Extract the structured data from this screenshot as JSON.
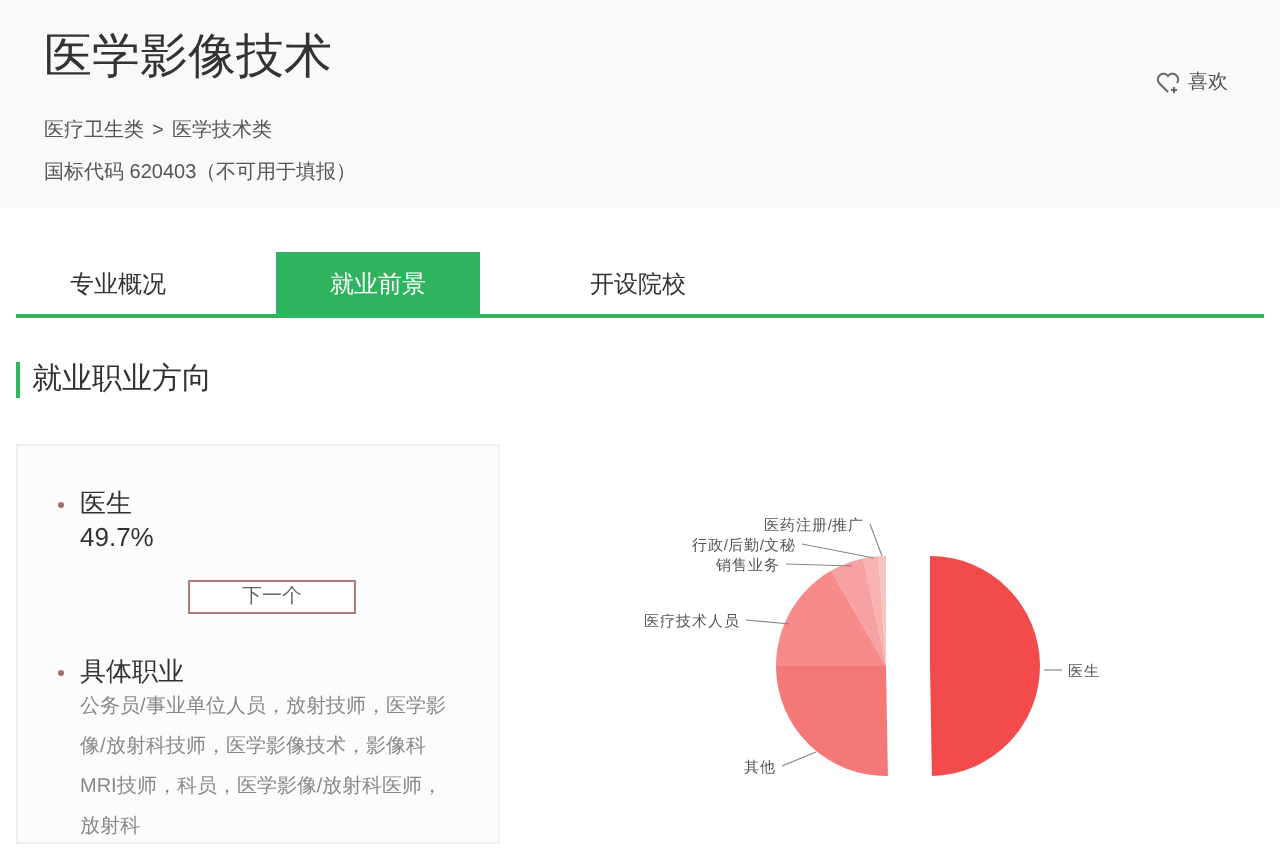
{
  "header": {
    "title": "医学影像技术",
    "like_label": "喜欢",
    "breadcrumb": [
      "医疗卫生类",
      "医学技术类"
    ],
    "breadcrumb_separator": ">",
    "code_line": "国标代码 620403（不可用于填报）"
  },
  "tabs": [
    {
      "label": "专业概况",
      "selected": false
    },
    {
      "label": "就业前景",
      "selected": true
    },
    {
      "label": "开设院校",
      "selected": false
    }
  ],
  "section_title": "就业职业方向",
  "detail": {
    "career": "医生",
    "share": "49.7%",
    "next_button": "下一个",
    "jobs_title": "具体职业",
    "jobs_text": "公务员/事业单位人员，放射技师，医学影像/放射科技师，医学影像技术，影像科MRI技师，科员，医学影像/放射科医师，放射科"
  },
  "pie_labels": [
    {
      "label": "医药注册/推广",
      "color": "#f9c4c4"
    },
    {
      "label": "行政/后勤/文秘",
      "color": "#f8b2b2"
    },
    {
      "label": "销售业务",
      "color": "#f6a2a2"
    },
    {
      "label": "医疗技术人员",
      "color": "#f78a8a"
    },
    {
      "label": "医生",
      "color": "#f24b4b"
    },
    {
      "label": "其他",
      "color": "#f57878"
    }
  ]
}
